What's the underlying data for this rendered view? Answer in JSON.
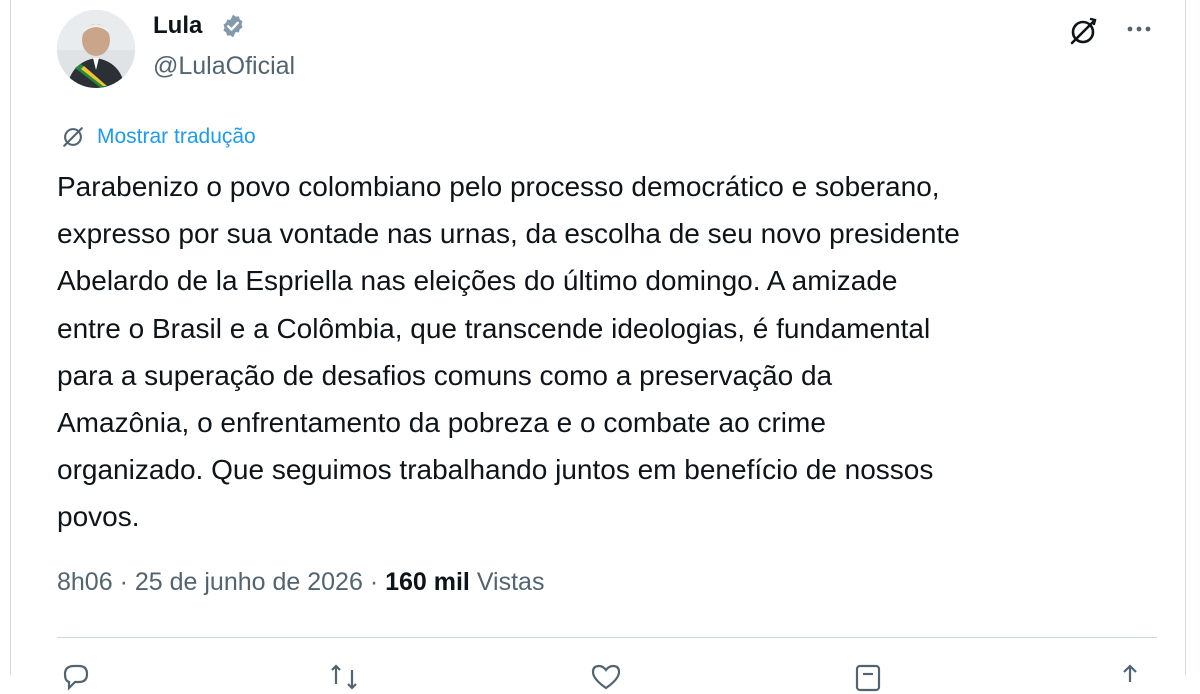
{
  "author": {
    "name": "Lula",
    "handle": "@LulaOficial",
    "verified": true
  },
  "translate_link": "Mostrar tradução",
  "tweet_lines": [
    "Parabenizo o povo colombiano pelo processo democrático e soberano,",
    "expresso por sua vontade nas urnas, da escolha de seu novo presidente",
    "Abelardo de la Espriella nas eleições do último domingo. A amizade",
    "entre o Brasil e a Colômbia, que transcende ideologias, é fundamental",
    "para a superação de desafios comuns como a preservação da",
    "Amazônia, o enfrentamento da pobreza e o combate ao crime",
    "organizado. Que seguimos trabalhando juntos em benefício de nossos",
    "povos."
  ],
  "meta": {
    "time": "8h06",
    "separator": "·",
    "date": "25 de junho de 2026",
    "views_count": "160 mil",
    "views_label": "Vistas"
  },
  "icons": {
    "grok": "grok-icon",
    "more": "more-icon",
    "translate": "translate-icon",
    "verified": "verified-badge-icon",
    "actions": [
      "reply-icon",
      "repost-icon",
      "like-icon",
      "bookmark-icon",
      "share-icon"
    ]
  },
  "colors": {
    "text": "#0f1419",
    "secondary": "#536471",
    "link": "#1d9bf0",
    "verified_badge": "#829aab",
    "border": "#cfd9de"
  }
}
